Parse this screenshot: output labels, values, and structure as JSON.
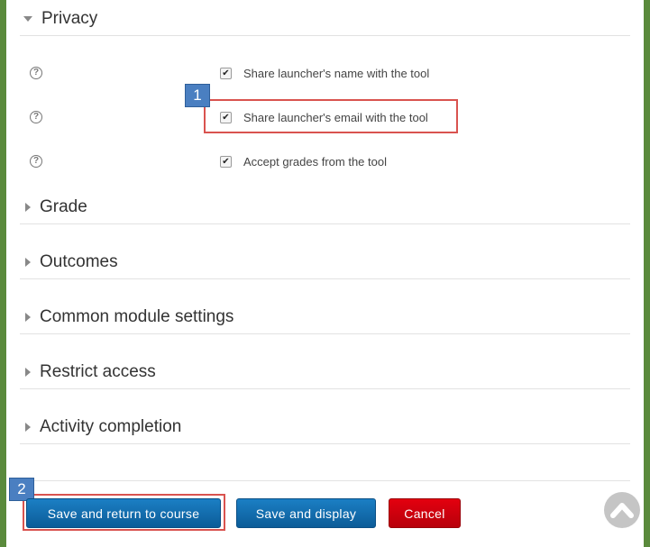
{
  "sections": {
    "privacy": "Privacy",
    "grade": "Grade",
    "outcomes": "Outcomes",
    "common": "Common module settings",
    "restrict": "Restrict access",
    "completion": "Activity completion"
  },
  "privacy_options": [
    {
      "label": "Share launcher's name with the tool",
      "checked": true
    },
    {
      "label": "Share launcher's email with the tool",
      "checked": true
    },
    {
      "label": "Accept grades from the tool",
      "checked": true
    }
  ],
  "help_glyph": "?",
  "check_glyph": "✔",
  "markers": {
    "one": "1",
    "two": "2"
  },
  "buttons": {
    "save_return": "Save and return to course",
    "save_display": "Save and display",
    "cancel": "Cancel"
  },
  "colors": {
    "accent_blue": "#0c68ad",
    "cancel_red": "#d2000e",
    "highlight_red": "#d9534f",
    "marker_blue": "#4a7fc1"
  },
  "icons": {
    "section_expanded": "triangle-down-icon",
    "section_collapsed": "triangle-right-icon",
    "help": "question-circle-icon",
    "scroll_top": "chevron-up-icon"
  }
}
